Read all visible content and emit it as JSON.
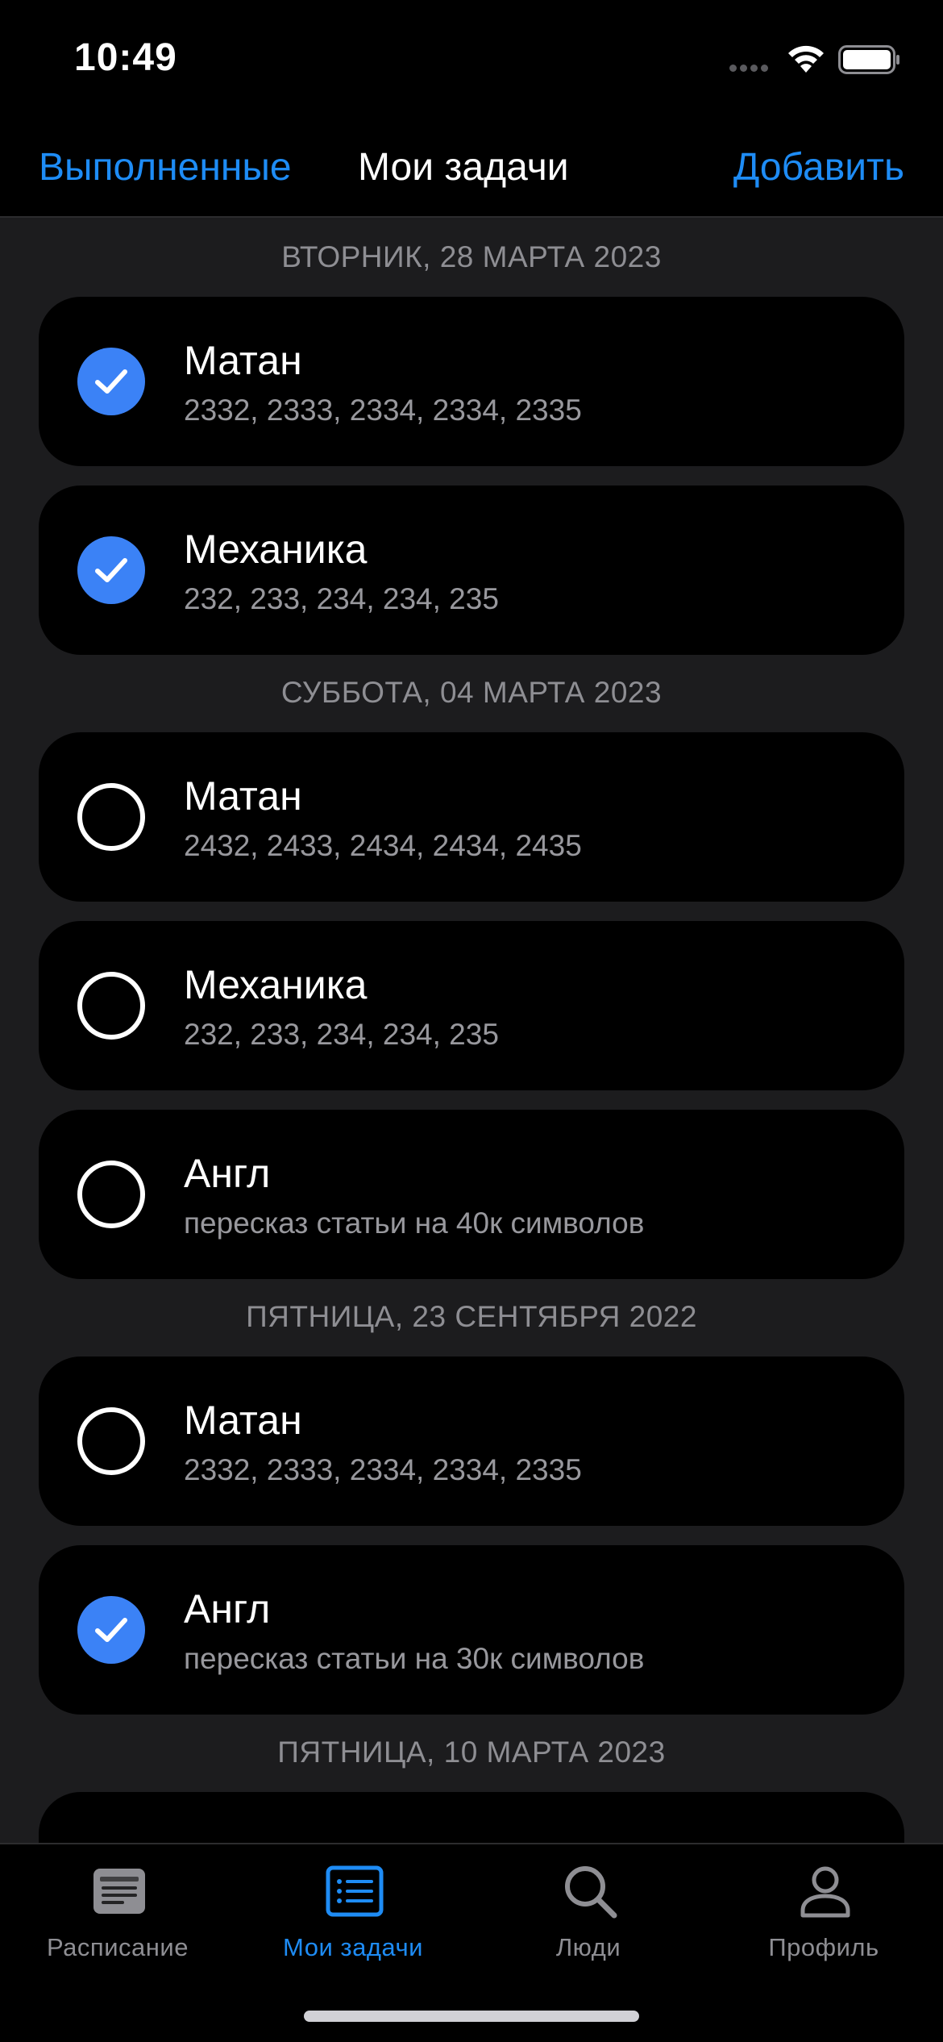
{
  "status_bar": {
    "time": "10:49",
    "icons": [
      "signal-dots-icon",
      "wifi-icon",
      "battery-icon"
    ]
  },
  "nav": {
    "left_label": "Выполненные",
    "title": "Мои задачи",
    "right_label": "Добавить",
    "accent_color": "#1e8cf5"
  },
  "sections": [
    {
      "header": "ВТОРНИК, 28 МАРТА 2023",
      "tasks": [
        {
          "title": "Матан",
          "subtitle": "2332, 2333, 2334, 2334, 2335",
          "done": true
        },
        {
          "title": "Механика",
          "subtitle": "232, 233, 234, 234, 235",
          "done": true
        }
      ]
    },
    {
      "header": "СУББОТА, 04 МАРТА 2023",
      "tasks": [
        {
          "title": "Матан",
          "subtitle": "2432, 2433, 2434, 2434, 2435",
          "done": false
        },
        {
          "title": "Механика",
          "subtitle": "232, 233, 234, 234, 235",
          "done": false
        },
        {
          "title": "Англ",
          "subtitle": "пересказ статьи на 40к символов",
          "done": false
        }
      ]
    },
    {
      "header": "ПЯТНИЦА, 23 СЕНТЯБРЯ 2022",
      "tasks": [
        {
          "title": "Матан",
          "subtitle": "2332, 2333, 2334, 2334, 2335",
          "done": false
        },
        {
          "title": "Англ",
          "subtitle": "пересказ статьи на 30к символов",
          "done": true
        }
      ]
    },
    {
      "header": "ПЯТНИЦА, 10 МАРТА 2023",
      "tasks": []
    }
  ],
  "tab_bar": {
    "tabs": [
      {
        "label": "Расписание",
        "icon": "schedule-icon",
        "active": false
      },
      {
        "label": "Мои задачи",
        "icon": "tasks-list-icon",
        "active": true
      },
      {
        "label": "Люди",
        "icon": "search-icon",
        "active": false
      },
      {
        "label": "Профиль",
        "icon": "profile-icon",
        "active": false
      }
    ]
  }
}
